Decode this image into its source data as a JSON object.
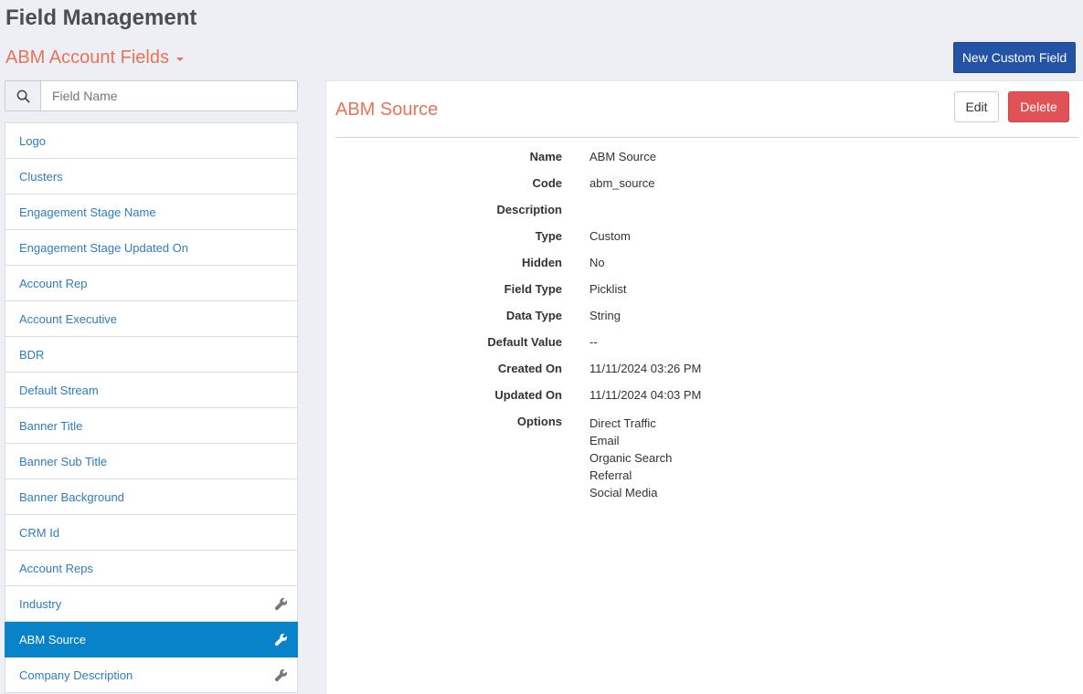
{
  "header": {
    "title": "Field Management",
    "section": "ABM Account Fields",
    "new_button": "New Custom Field"
  },
  "search": {
    "placeholder": "Field Name",
    "value": ""
  },
  "fields": [
    {
      "label": "Logo",
      "custom": false,
      "active": false
    },
    {
      "label": "Clusters",
      "custom": false,
      "active": false
    },
    {
      "label": "Engagement Stage Name",
      "custom": false,
      "active": false
    },
    {
      "label": "Engagement Stage Updated On",
      "custom": false,
      "active": false
    },
    {
      "label": "Account Rep",
      "custom": false,
      "active": false
    },
    {
      "label": "Account Executive",
      "custom": false,
      "active": false
    },
    {
      "label": "BDR",
      "custom": false,
      "active": false
    },
    {
      "label": "Default Stream",
      "custom": false,
      "active": false
    },
    {
      "label": "Banner Title",
      "custom": false,
      "active": false
    },
    {
      "label": "Banner Sub Title",
      "custom": false,
      "active": false
    },
    {
      "label": "Banner Background",
      "custom": false,
      "active": false
    },
    {
      "label": "CRM Id",
      "custom": false,
      "active": false
    },
    {
      "label": "Account Reps",
      "custom": false,
      "active": false
    },
    {
      "label": "Industry",
      "custom": true,
      "active": false
    },
    {
      "label": "ABM Source",
      "custom": true,
      "active": true
    },
    {
      "label": "Company Description",
      "custom": true,
      "active": false
    }
  ],
  "detail": {
    "title": "ABM Source",
    "edit_label": "Edit",
    "delete_label": "Delete",
    "properties": [
      {
        "label": "Name",
        "value": "ABM Source"
      },
      {
        "label": "Code",
        "value": "abm_source"
      },
      {
        "label": "Description",
        "value": ""
      },
      {
        "label": "Type",
        "value": "Custom"
      },
      {
        "label": "Hidden",
        "value": "No"
      },
      {
        "label": "Field Type",
        "value": "Picklist"
      },
      {
        "label": "Data Type",
        "value": "String"
      },
      {
        "label": "Default Value",
        "value": "--"
      },
      {
        "label": "Created On",
        "value": "11/11/2024 03:26 PM"
      },
      {
        "label": "Updated On",
        "value": "11/11/2024 04:03 PM"
      }
    ],
    "options_label": "Options",
    "options": [
      "Direct Traffic",
      "Email",
      "Organic Search",
      "Referral",
      "Social Media"
    ]
  },
  "colors": {
    "accent_orange": "#e8735a",
    "primary_blue": "#2453a6",
    "active_item": "#0882c8",
    "link_blue": "#2f7cc0",
    "danger": "#e15257"
  },
  "icons": {
    "search": "search-icon",
    "wrench": "wrench-icon",
    "caret": "caret-down-icon"
  }
}
